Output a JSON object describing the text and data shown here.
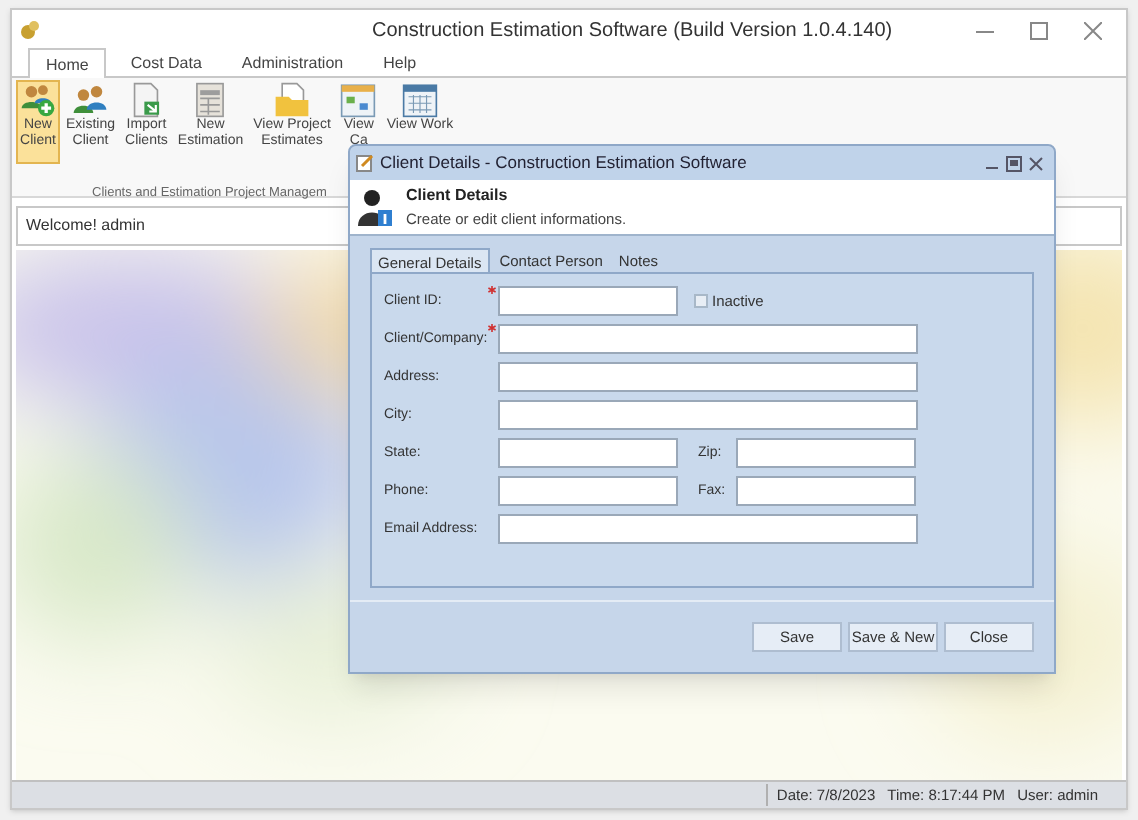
{
  "window": {
    "title": "Construction Estimation Software (Build Version 1.0.4.140)"
  },
  "ribbon": {
    "tabs": [
      {
        "label": "Home",
        "selected": true
      },
      {
        "label": "Cost Data",
        "selected": false
      },
      {
        "label": "Administration",
        "selected": false
      },
      {
        "label": "Help",
        "selected": false
      }
    ],
    "buttons": [
      {
        "lines": [
          "New",
          "Client"
        ],
        "selected": true
      },
      {
        "lines": [
          "Existing",
          "Client"
        ],
        "selected": false
      },
      {
        "lines": [
          "Import",
          "Clients"
        ],
        "selected": false
      },
      {
        "lines": [
          "New",
          "Estimation"
        ],
        "selected": false
      },
      {
        "lines": [
          "View Project",
          "Estimates"
        ],
        "selected": false
      },
      {
        "lines": [
          "View",
          "Ca"
        ],
        "selected": false
      },
      {
        "lines": [
          "View Work"
        ],
        "selected": false
      }
    ],
    "group_label": "Clients and Estimation Project Managem"
  },
  "welcome": "Welcome! admin",
  "dialog": {
    "title": "Client Details - Construction Estimation Software",
    "header": {
      "title": "Client Details",
      "subtitle": "Create or edit client informations."
    },
    "tabs": [
      {
        "label": "General Details",
        "selected": true
      },
      {
        "label": "Contact Person",
        "selected": false
      },
      {
        "label": "Notes",
        "selected": false
      }
    ],
    "rows": [
      {
        "items": [
          {
            "kind": "field",
            "label": "Client ID:",
            "required": true
          },
          {
            "kind": "checkbox",
            "label": "Inactive",
            "checked": false
          }
        ]
      },
      {
        "items": [
          {
            "kind": "field",
            "label": "Client/Company:",
            "required": true
          }
        ]
      },
      {
        "items": [
          {
            "kind": "field",
            "label": "Address:",
            "required": false
          }
        ]
      },
      {
        "items": [
          {
            "kind": "field",
            "label": "City:",
            "required": false
          }
        ]
      },
      {
        "items": [
          {
            "kind": "field",
            "label": "State:",
            "required": false
          },
          {
            "kind": "field",
            "label": "Zip:",
            "required": false
          }
        ]
      },
      {
        "items": [
          {
            "kind": "field",
            "label": "Phone:",
            "required": false
          },
          {
            "kind": "field",
            "label": "Fax:",
            "required": false
          }
        ]
      },
      {
        "items": [
          {
            "kind": "field",
            "label": "Email Address:",
            "required": false
          }
        ]
      }
    ],
    "buttons": [
      "Save",
      "Save & New",
      "Close"
    ]
  },
  "status_bar": {
    "date": "Date: 7/8/2023",
    "time": "Time: 8:17:44 PM",
    "user": "User: admin"
  }
}
